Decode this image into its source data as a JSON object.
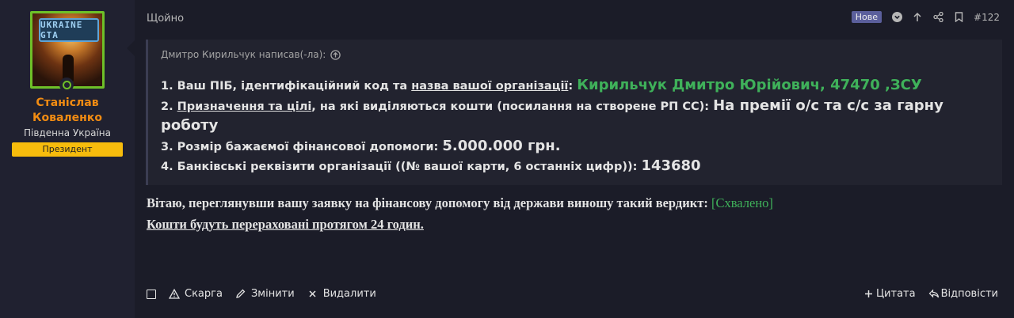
{
  "user": {
    "name": "Станіслав Коваленко",
    "region": "Південна Україна",
    "role": "Президент",
    "avatar_logo_text": "UKRAINE GTA"
  },
  "post": {
    "time": "Щойно",
    "badge_new": "Нове",
    "number": "#122"
  },
  "quote": {
    "author": "Дмитро Кирильчук написав(-ла):",
    "lines": {
      "l1_prefix": "1. Ваш ПІБ, ідентифікаційний код та ",
      "l1_link": "назва вашої організації",
      "l1_colon": ": ",
      "l1_answer": "Кирильчук Дмитро Юрійович, 47470 ,ЗСУ",
      "l2_num": "2. ",
      "l2_link": "Призначення та цілі",
      "l2_rest": ", на які виділяються кошти (посилання на створене РП СС): ",
      "l2_answer": "На премії о/с та с/с за гарну роботу",
      "l3_prefix": "3. Розмір бажаємої фінансової допомоги: ",
      "l3_answer": "5.000.000 грн.",
      "l4_prefix": "4. Банківські реквізити організації ((№ вашої карти, 6 останніх цифр)): ",
      "l4_answer": "143680"
    }
  },
  "verdict": {
    "text": "Вітаю, переглянувши вашу заявку на фінансову допомогу від держави виношу такий вердикт: ",
    "status": "[Схвалено]",
    "line2": "Кошти будуть перераховані протягом 24 годин."
  },
  "actions": {
    "report": "Скарга",
    "edit": "Змінити",
    "delete": "Видалити",
    "quote": "Цитата",
    "reply": "Відповісти"
  },
  "colors": {
    "accent_green": "#3fb15a",
    "name_orange": "#f28c12",
    "role_yellow": "#f7bc0c",
    "badge_purple": "#5b5f9c"
  }
}
